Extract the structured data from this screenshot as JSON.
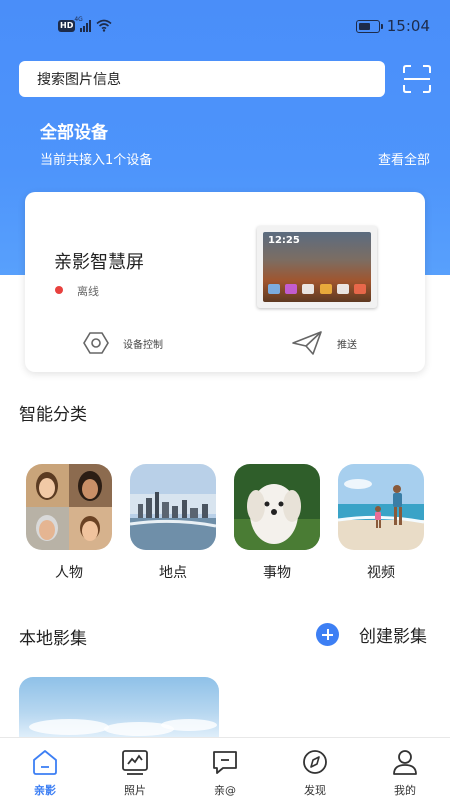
{
  "status_bar": {
    "hd": "HD",
    "network": "4G",
    "battery_level": 0.6,
    "time": "15:04"
  },
  "search": {
    "placeholder": "搜索图片信息"
  },
  "hero": {
    "title": "全部设备",
    "subtitle": "当前共接入1个设备",
    "view_all": "查看全部"
  },
  "device": {
    "name": "亲影智慧屏",
    "status": "离线",
    "status_color": "#e8413e",
    "screen_time": "12:25",
    "actions": [
      {
        "label": "设备控制",
        "icon": "hexagon-settings-icon"
      },
      {
        "label": "推送",
        "icon": "paper-plane-icon"
      }
    ]
  },
  "smart_categories": {
    "title": "智能分类",
    "items": [
      {
        "label": "人物",
        "icon": "people-photo"
      },
      {
        "label": "地点",
        "icon": "city-photo"
      },
      {
        "label": "事物",
        "icon": "dog-photo"
      },
      {
        "label": "视频",
        "icon": "beach-photo"
      }
    ]
  },
  "local_albums": {
    "title": "本地影集",
    "create_label": "创建影集"
  },
  "accent_color": "#3d7ff4",
  "nav": [
    {
      "label": "亲影",
      "icon": "home-icon",
      "active": true
    },
    {
      "label": "照片",
      "icon": "photos-icon",
      "active": false
    },
    {
      "label": "亲@",
      "icon": "chat-icon",
      "active": false
    },
    {
      "label": "发现",
      "icon": "compass-icon",
      "active": false
    },
    {
      "label": "我的",
      "icon": "profile-icon",
      "active": false
    }
  ]
}
